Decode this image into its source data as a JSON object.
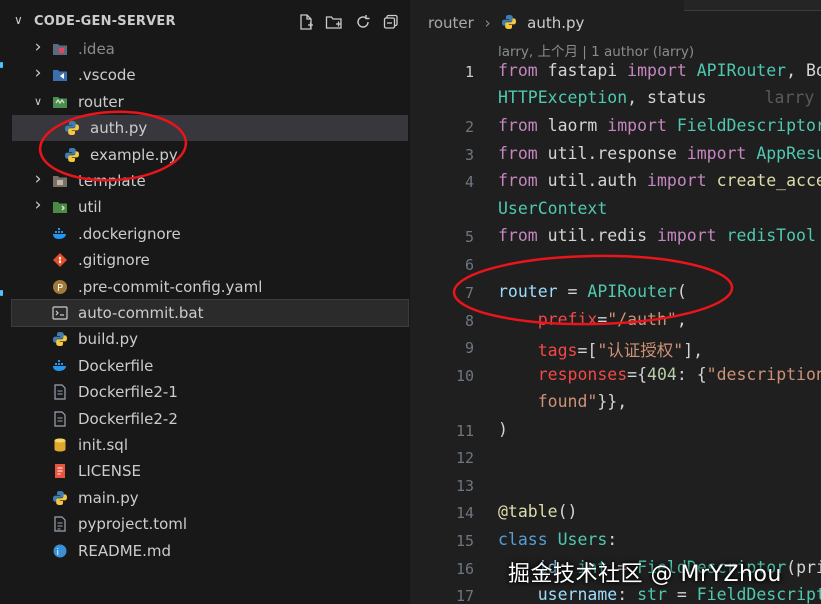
{
  "explorer": {
    "title": "CODE-GEN-SERVER",
    "toolbar": [
      "new-file-icon",
      "new-folder-icon",
      "refresh-icon",
      "collapse-all-icon"
    ],
    "items": [
      {
        "label": ".idea",
        "kind": "folder",
        "icon": "idea-folder-icon",
        "dim": true
      },
      {
        "label": ".vscode",
        "kind": "folder",
        "icon": "vscode-folder-icon"
      },
      {
        "label": "router",
        "kind": "folder-open",
        "icon": "router-folder-icon"
      },
      {
        "label": "auth.py",
        "kind": "file",
        "icon": "python-icon",
        "indent": 1
      },
      {
        "label": "example.py",
        "kind": "file",
        "icon": "python-icon",
        "indent": 1
      },
      {
        "label": "template",
        "kind": "folder",
        "icon": "template-folder-icon"
      },
      {
        "label": "util",
        "kind": "folder",
        "icon": "util-folder-icon"
      },
      {
        "label": ".dockerignore",
        "kind": "file",
        "icon": "docker-icon"
      },
      {
        "label": ".gitignore",
        "kind": "file",
        "icon": "git-icon"
      },
      {
        "label": ".pre-commit-config.yaml",
        "kind": "file",
        "icon": "pre-commit-icon"
      },
      {
        "label": "auto-commit.bat",
        "kind": "file",
        "icon": "terminal-icon"
      },
      {
        "label": "build.py",
        "kind": "file",
        "icon": "python-icon"
      },
      {
        "label": "Dockerfile",
        "kind": "file",
        "icon": "docker-icon"
      },
      {
        "label": "Dockerfile2-1",
        "kind": "file",
        "icon": "file-icon"
      },
      {
        "label": "Dockerfile2-2",
        "kind": "file",
        "icon": "file-icon"
      },
      {
        "label": "init.sql",
        "kind": "file",
        "icon": "database-icon"
      },
      {
        "label": "LICENSE",
        "kind": "file",
        "icon": "license-icon"
      },
      {
        "label": "main.py",
        "kind": "file",
        "icon": "python-icon"
      },
      {
        "label": "pyproject.toml",
        "kind": "file",
        "icon": "toml-icon"
      },
      {
        "label": "README.md",
        "kind": "file",
        "icon": "markdown-icon"
      }
    ]
  },
  "editor": {
    "breadcrumb": [
      "router",
      "auth.py"
    ],
    "blame": "larry, 上个月 | 1 author (larry)",
    "inline_blame": "larry",
    "lines": [
      {
        "n": "1",
        "cur": true,
        "tokens": [
          [
            "k",
            "from"
          ],
          [
            "v",
            " fastapi "
          ],
          [
            "k",
            "import"
          ],
          [
            "v",
            " "
          ],
          [
            "t",
            "APIRouter"
          ],
          [
            "v",
            ", Bo"
          ]
        ]
      },
      {
        "n": "",
        "tokens": [
          [
            "t",
            "HTTPException"
          ],
          [
            "v",
            ", status"
          ]
        ]
      },
      {
        "n": "2",
        "tokens": [
          [
            "k",
            "from"
          ],
          [
            "v",
            " laorm "
          ],
          [
            "k",
            "import"
          ],
          [
            "v",
            " "
          ],
          [
            "t",
            "FieldDescriptor"
          ]
        ]
      },
      {
        "n": "3",
        "tokens": [
          [
            "k",
            "from"
          ],
          [
            "v",
            " util.response "
          ],
          [
            "k",
            "import"
          ],
          [
            "v",
            " "
          ],
          [
            "t",
            "AppResu"
          ]
        ]
      },
      {
        "n": "4",
        "tokens": [
          [
            "k",
            "from"
          ],
          [
            "v",
            " util.auth "
          ],
          [
            "k",
            "import"
          ],
          [
            "v",
            " "
          ],
          [
            "f",
            "create_acce"
          ]
        ]
      },
      {
        "n": "",
        "tokens": [
          [
            "t",
            "UserContext"
          ]
        ]
      },
      {
        "n": "5",
        "tokens": [
          [
            "k",
            "from"
          ],
          [
            "v",
            " util.redis "
          ],
          [
            "k",
            "import"
          ],
          [
            "v",
            " "
          ],
          [
            "t",
            "redisTool"
          ]
        ]
      },
      {
        "n": "6",
        "tokens": []
      },
      {
        "n": "7",
        "tokens": [
          [
            "p",
            "router"
          ],
          [
            "v",
            " = "
          ],
          [
            "t",
            "APIRouter"
          ],
          [
            "v",
            "("
          ]
        ]
      },
      {
        "n": "8",
        "tokens": [
          [
            "v",
            "    "
          ],
          [
            "o",
            "prefix"
          ],
          [
            "v",
            "="
          ],
          [
            "s",
            "\"/auth\""
          ],
          [
            "v",
            ","
          ]
        ]
      },
      {
        "n": "9",
        "tokens": [
          [
            "v",
            "    "
          ],
          [
            "o",
            "tags"
          ],
          [
            "v",
            "=["
          ],
          [
            "s",
            "\"认证授权\""
          ],
          [
            "v",
            "],"
          ]
        ]
      },
      {
        "n": "10",
        "tokens": [
          [
            "v",
            "    "
          ],
          [
            "o",
            "responses"
          ],
          [
            "v",
            "={"
          ],
          [
            "n",
            "404"
          ],
          [
            "v",
            ": {"
          ],
          [
            "s",
            "\"description"
          ]
        ]
      },
      {
        "n": "",
        "tokens": [
          [
            "v",
            "    "
          ],
          [
            "s",
            "found\""
          ],
          [
            "v",
            "}},"
          ]
        ]
      },
      {
        "n": "11",
        "tokens": [
          [
            "v",
            ")"
          ]
        ]
      },
      {
        "n": "12",
        "tokens": []
      },
      {
        "n": "13",
        "tokens": []
      },
      {
        "n": "14",
        "tokens": [
          [
            "d",
            "@table"
          ],
          [
            "v",
            "()"
          ]
        ]
      },
      {
        "n": "15",
        "tokens": [
          [
            "b",
            "class"
          ],
          [
            "v",
            " "
          ],
          [
            "t",
            "Users"
          ],
          [
            "v",
            ":"
          ]
        ]
      },
      {
        "n": "16",
        "tokens": [
          [
            "v",
            "    "
          ],
          [
            "p",
            "id"
          ],
          [
            "v",
            ": "
          ],
          [
            "t",
            "int"
          ],
          [
            "v",
            " = "
          ],
          [
            "t",
            "FieldDescriptor"
          ],
          [
            "v",
            "(pri"
          ]
        ]
      },
      {
        "n": "17",
        "tokens": [
          [
            "v",
            "    "
          ],
          [
            "p",
            "username"
          ],
          [
            "v",
            ": "
          ],
          [
            "t",
            "str"
          ],
          [
            "v",
            " = "
          ],
          [
            "t",
            "FieldDescript"
          ]
        ]
      }
    ]
  },
  "watermark": "掘金技术社区 @ MrYZhou",
  "colors": {
    "sidebar_bg": "#181818",
    "editor_bg": "#1f1f1f",
    "annotation_red": "#e8151b",
    "selected_row": "#37373d"
  }
}
